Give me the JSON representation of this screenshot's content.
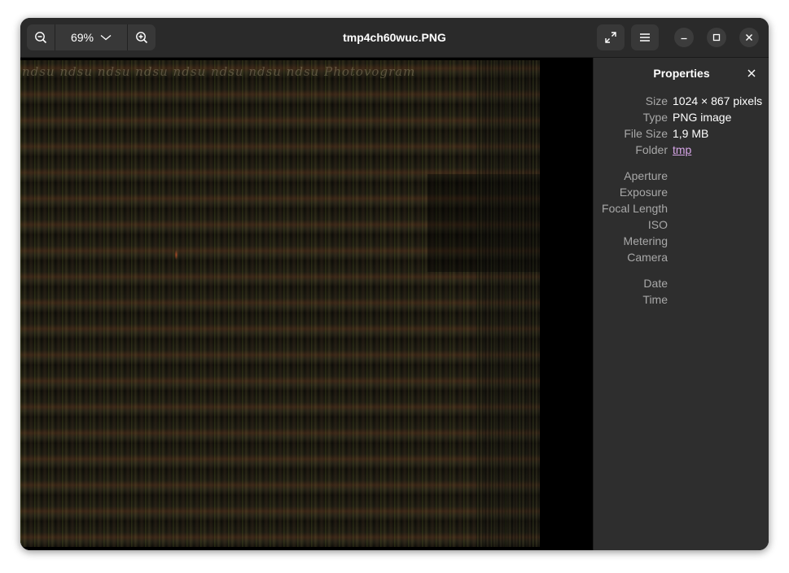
{
  "window": {
    "title": "tmp4ch60wuc.PNG"
  },
  "toolbar": {
    "zoom_value": "69%"
  },
  "image": {
    "watermark_text": "ndsu  ndsu  ndsu  ndsu  ndsu  ndsu  ndsu  ndsu  Photovogram"
  },
  "properties": {
    "title": "Properties",
    "file": [
      {
        "key": "Size",
        "value": "1024 × 867 pixels"
      },
      {
        "key": "Type",
        "value": "PNG image"
      },
      {
        "key": "File Size",
        "value": "1,9 MB"
      },
      {
        "key": "Folder",
        "value": "tmp"
      }
    ],
    "camera": [
      {
        "key": "Aperture",
        "value": ""
      },
      {
        "key": "Exposure",
        "value": ""
      },
      {
        "key": "Focal Length",
        "value": ""
      },
      {
        "key": "ISO",
        "value": ""
      },
      {
        "key": "Metering",
        "value": ""
      },
      {
        "key": "Camera",
        "value": ""
      }
    ],
    "datetime": [
      {
        "key": "Date",
        "value": ""
      },
      {
        "key": "Time",
        "value": ""
      }
    ]
  },
  "colors": {
    "titlebar_bg": "#2a2a2a",
    "sidebar_bg": "#2e2e2e",
    "link": "#d7a6e8"
  },
  "icons": {
    "zoom_out": "zoom-out-icon",
    "zoom_in": "zoom-in-icon",
    "dropdown": "chevron-down-icon",
    "fullscreen": "fullscreen-icon",
    "menu": "hamburger-menu-icon",
    "minimize": "minimize-icon",
    "maximize": "maximize-icon",
    "close": "close-icon"
  }
}
